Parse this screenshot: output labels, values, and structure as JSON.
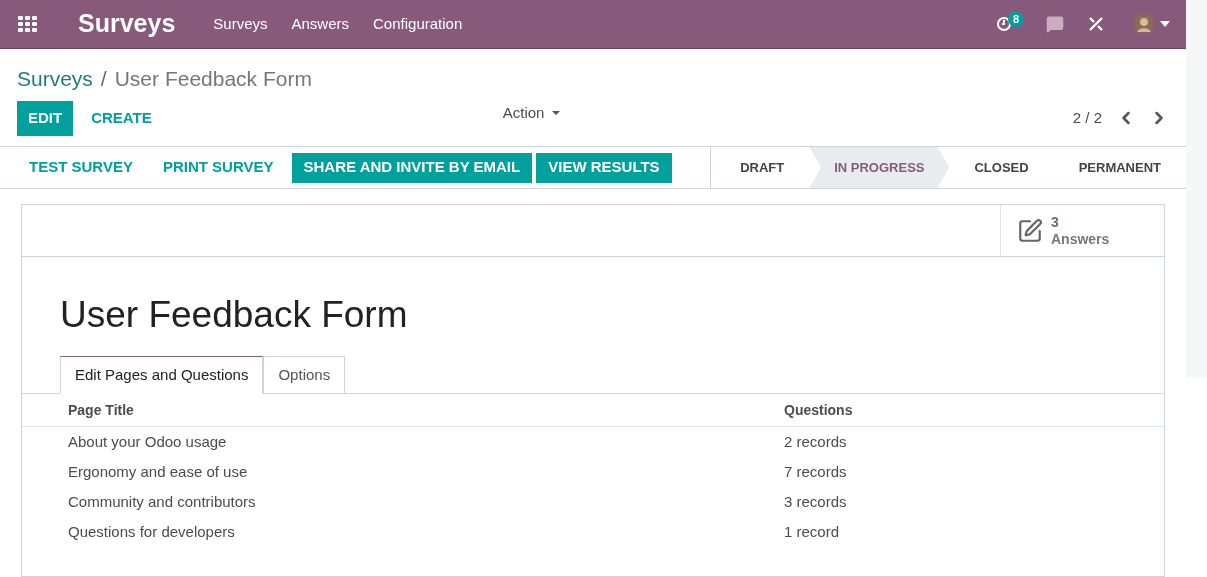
{
  "navbar": {
    "app_title": "Surveys",
    "menu": [
      "Surveys",
      "Answers",
      "Configuration"
    ],
    "activity_count": "8"
  },
  "breadcrumb": {
    "parent": "Surveys",
    "separator": "/",
    "current": "User Feedback Form"
  },
  "control_panel": {
    "edit": "EDIT",
    "create": "CREATE",
    "action": "Action",
    "pager": "2 / 2"
  },
  "header_buttons": [
    {
      "label": "TEST SURVEY",
      "kind": "link"
    },
    {
      "label": "PRINT SURVEY",
      "kind": "link"
    },
    {
      "label": "SHARE AND INVITE BY EMAIL",
      "kind": "primary"
    },
    {
      "label": "VIEW RESULTS",
      "kind": "primary"
    }
  ],
  "stages": [
    {
      "label": "DRAFT",
      "selected": false
    },
    {
      "label": "IN PROGRESS",
      "selected": true
    },
    {
      "label": "CLOSED",
      "selected": false
    },
    {
      "label": "PERMANENT",
      "selected": false
    }
  ],
  "smart_button": {
    "count": "3",
    "label": "Answers"
  },
  "title": "User Feedback Form",
  "tabs": [
    {
      "label": "Edit Pages and Questions",
      "selected": true
    },
    {
      "label": "Options",
      "selected": false
    }
  ],
  "table": {
    "columns": [
      "Page Title",
      "Questions"
    ],
    "rows": [
      {
        "page_title": "About your Odoo usage",
        "questions": "2 records"
      },
      {
        "page_title": "Ergonomy and ease of use",
        "questions": "7 records"
      },
      {
        "page_title": "Community and contributors",
        "questions": "3 records"
      },
      {
        "page_title": "Questions for developers",
        "questions": "1 record"
      }
    ]
  }
}
